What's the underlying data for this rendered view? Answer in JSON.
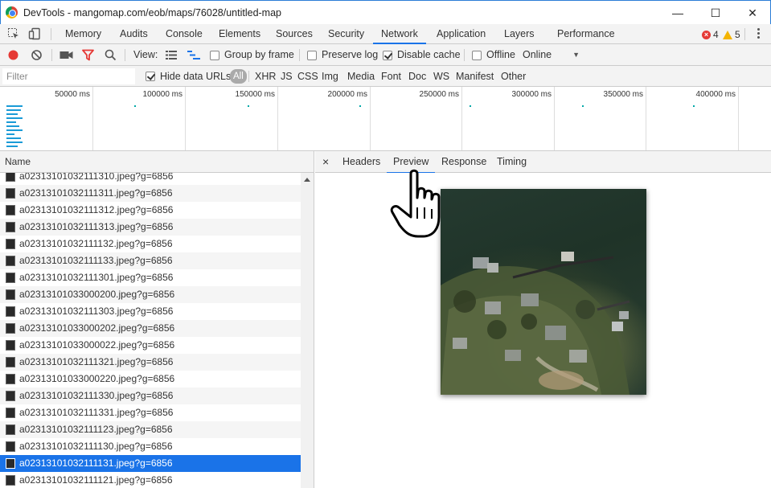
{
  "window": {
    "title": "DevTools - mangomap.com/eob/maps/76028/untitled-map",
    "minimize_glyph": "—",
    "maximize_glyph": "☐",
    "close_glyph": "✕"
  },
  "tabs": [
    {
      "label": "Memory"
    },
    {
      "label": "Audits"
    },
    {
      "label": "Console"
    },
    {
      "label": "Elements"
    },
    {
      "label": "Sources"
    },
    {
      "label": "Security"
    },
    {
      "label": "Network"
    },
    {
      "label": "Application"
    },
    {
      "label": "Layers"
    },
    {
      "label": "Performance"
    }
  ],
  "active_tab": "Network",
  "status": {
    "errors": "4",
    "warnings": "5"
  },
  "network_toolbar": {
    "view_label": "View:",
    "group_by_frame": {
      "label": "Group by frame",
      "checked": false
    },
    "preserve_log": {
      "label": "Preserve log",
      "checked": false
    },
    "disable_cache": {
      "label": "Disable cache",
      "checked": true
    },
    "offline": {
      "label": "Offline",
      "checked": false
    },
    "throttle": "Online"
  },
  "filterbar": {
    "placeholder": "Filter",
    "hide_data_urls": {
      "label": "Hide data URLs",
      "checked": true
    },
    "types": [
      "All",
      "XHR",
      "JS",
      "CSS",
      "Img",
      "Media",
      "Font",
      "Doc",
      "WS",
      "Manifest",
      "Other"
    ],
    "active_type": "All"
  },
  "overview": {
    "ticks": [
      "50000 ms",
      "100000 ms",
      "150000 ms",
      "200000 ms",
      "250000 ms",
      "300000 ms",
      "350000 ms",
      "400000 ms"
    ]
  },
  "list": {
    "header": "Name",
    "rows": [
      "a02313101032111310.jpeg?g=6856",
      "a02313101032111311.jpeg?g=6856",
      "a02313101032111312.jpeg?g=6856",
      "a02313101032111313.jpeg?g=6856",
      "a02313101032111132.jpeg?g=6856",
      "a02313101032111133.jpeg?g=6856",
      "a02313101032111301.jpeg?g=6856",
      "a02313101033000200.jpeg?g=6856",
      "a02313101032111303.jpeg?g=6856",
      "a02313101033000202.jpeg?g=6856",
      "a02313101033000022.jpeg?g=6856",
      "a02313101032111321.jpeg?g=6856",
      "a02313101033000220.jpeg?g=6856",
      "a02313101032111330.jpeg?g=6856",
      "a02313101032111331.jpeg?g=6856",
      "a02313101032111123.jpeg?g=6856",
      "a02313101032111130.jpeg?g=6856",
      "a02313101032111131.jpeg?g=6856",
      "a02313101032111121.jpeg?g=6856"
    ],
    "selected_index": 17
  },
  "detail": {
    "close_glyph": "×",
    "tabs": [
      "Headers",
      "Preview",
      "Response",
      "Timing"
    ],
    "active_tab": "Preview"
  },
  "colors": {
    "accent": "#1a73e8",
    "record": "#e53935",
    "filter_icon": "#e53935"
  }
}
